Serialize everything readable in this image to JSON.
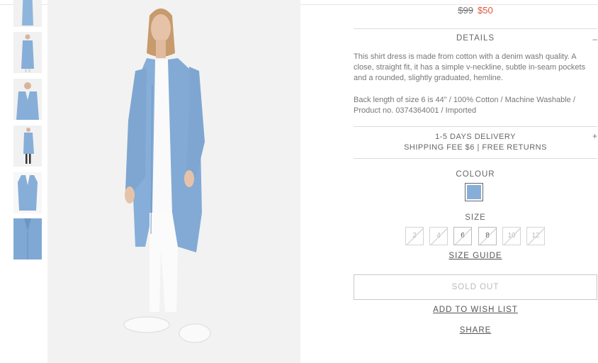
{
  "price": {
    "old": "$99",
    "new": "$50"
  },
  "details": {
    "heading": "DETAILS",
    "toggle": "–",
    "description": "This shirt dress is made from cotton with a denim wash quality. A close, straight fit, it has a simple v-neckline, subtle in-seam pockets and a rounded, slightly graduated, hemline.",
    "specs": "Back length of size 6 is 44\"  / 100% Cotton / Machine Washable / Product no. 0374364001 / Imported"
  },
  "delivery": {
    "line1": "1-5 DAYS DELIVERY",
    "line2": "SHIPPING FEE $6 | FREE RETURNS",
    "toggle": "+"
  },
  "colour": {
    "label": "COLOUR",
    "swatch_color": "#86aed8"
  },
  "size": {
    "label": "SIZE",
    "options": [
      {
        "label": "2",
        "available": false
      },
      {
        "label": "4",
        "available": false
      },
      {
        "label": "6",
        "available": true
      },
      {
        "label": "8",
        "available": true
      },
      {
        "label": "10",
        "available": false
      },
      {
        "label": "12",
        "available": false
      }
    ],
    "guide": "SIZE GUIDE"
  },
  "actions": {
    "sold_out": "SOLD OUT",
    "wish_list": "ADD TO WISH LIST",
    "share": "SHARE"
  },
  "colors": {
    "accent": "#e0573a",
    "denim": "#86aed8"
  }
}
